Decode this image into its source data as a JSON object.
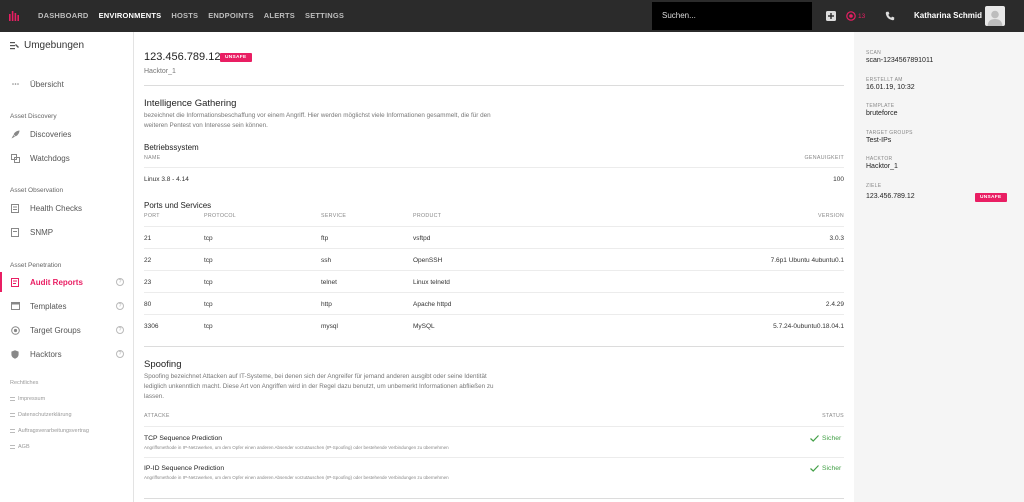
{
  "topbar": {
    "nav": [
      "DASHBOARD",
      "ENVIRONMENTS",
      "HOSTS",
      "ENDPOINTS",
      "ALERTS",
      "SETTINGS"
    ],
    "search_placeholder": "Suchen...",
    "alert_count": "13",
    "user_name": "Katharina Schmid"
  },
  "sidebar": {
    "title": "Umgebungen",
    "overview": "Übersicht",
    "sections": {
      "discovery": "Asset Discovery",
      "observation": "Asset Observation",
      "penetration": "Asset Penetration"
    },
    "items": {
      "discoveries": "Discoveries",
      "watchdogs": "Watchdogs",
      "health_checks": "Health Checks",
      "snmp": "SNMP",
      "audit_reports": "Audit Reports",
      "templates": "Templates",
      "target_groups": "Target Groups",
      "hacktors": "Hacktors"
    },
    "help_glyph": "?",
    "legal_title": "Rechtliches",
    "legal": [
      "Impressum",
      "Datenschutzerklärung",
      "Auftragsverarbeitungsvertrag",
      "AGB"
    ]
  },
  "main": {
    "ip": "123.456.789.12",
    "badge": "UNSAFE",
    "hacktor": "Hacktor_1",
    "intel": {
      "title": "Intelligence Gathering",
      "desc": "bezeichnet die Informationsbeschaffung vor einem Angriff. Hier werden möglichst viele Informationen gesammelt, die für den weiteren Pentest von Interesse sein können."
    },
    "os": {
      "title": "Betriebssystem",
      "col_name": "NAME",
      "col_acc": "GENAUIGKEIT",
      "name": "Linux 3.8 - 4.14",
      "accuracy": "100"
    },
    "ports": {
      "title": "Ports und Services",
      "cols": {
        "port": "PORT",
        "protocol": "PROTOCOL",
        "service": "SERVICE",
        "product": "PRODUCT",
        "version": "VERSION"
      },
      "rows": [
        {
          "port": "21",
          "protocol": "tcp",
          "service": "ftp",
          "product": "vsftpd",
          "version": "3.0.3"
        },
        {
          "port": "22",
          "protocol": "tcp",
          "service": "ssh",
          "product": "OpenSSH",
          "version": "7.6p1 Ubuntu 4ubuntu0.1"
        },
        {
          "port": "23",
          "protocol": "tcp",
          "service": "telnet",
          "product": "Linux telnetd",
          "version": ""
        },
        {
          "port": "80",
          "protocol": "tcp",
          "service": "http",
          "product": "Apache httpd",
          "version": "2.4.29"
        },
        {
          "port": "3306",
          "protocol": "tcp",
          "service": "mysql",
          "product": "MySQL",
          "version": "5.7.24-0ubuntu0.18.04.1"
        }
      ]
    },
    "spoofing": {
      "title": "Spoofing",
      "desc": "Spoofing bezeichnet Attacken auf IT-Systeme, bei denen sich der Angreifer für jemand anderen ausgibt oder seine Identität lediglich unkenntlich macht. Diese Art von Angriffen wird in der Regel dazu benutzt, um unbemerkt Informationen abfließen zu lassen.",
      "col_attack": "ATTACKE",
      "col_status": "STATUS",
      "rows": [
        {
          "name": "TCP Sequence Prediction",
          "desc": "Angriffsmethode in IP-Netzwerken, um dem Opfer einen anderen Absender vorzutäuschen (IP-Spoofing) oder bestehende Verbindungen zu übernehmen",
          "status": "Sicher"
        },
        {
          "name": "IP-ID Sequence Prediction",
          "desc": "Angriffsmethode in IP-Netzwerken, um dem Opfer einen anderen Absender vorzutäuschen (IP-Spoofing) oder bestehende Verbindungen zu übernehmen",
          "status": "Sicher"
        }
      ]
    }
  },
  "rpanel": {
    "scan_label": "SCAN",
    "scan": "scan-1234567891011",
    "created_label": "ERSTELLT AM",
    "created": "16.01.19, 10:32",
    "template_label": "TEMPLATE",
    "template": "bruteforce",
    "tg_label": "TARGET GROUPS",
    "tg": "Test-IPs",
    "hacktor_label": "HACKTOR",
    "hacktor": "Hacktor_1",
    "ziele_label": "ZIELE",
    "ziel": "123.456.789.12",
    "ziel_badge": "UNSAFE"
  },
  "colors": {
    "accent": "#e91e63",
    "success": "#43a047",
    "topbar": "#2b2b2b"
  }
}
